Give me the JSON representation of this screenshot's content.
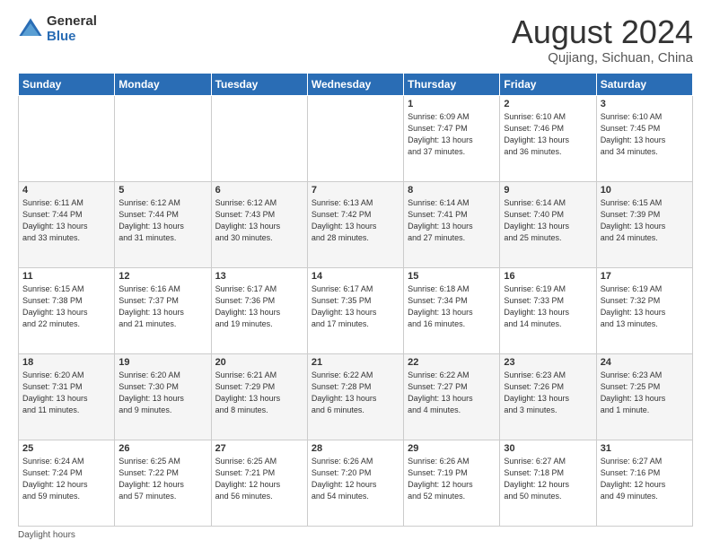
{
  "logo": {
    "general": "General",
    "blue": "Blue"
  },
  "title": "August 2024",
  "subtitle": "Qujiang, Sichuan, China",
  "days_of_week": [
    "Sunday",
    "Monday",
    "Tuesday",
    "Wednesday",
    "Thursday",
    "Friday",
    "Saturday"
  ],
  "footer": "Daylight hours",
  "weeks": [
    [
      {
        "day": "",
        "info": ""
      },
      {
        "day": "",
        "info": ""
      },
      {
        "day": "",
        "info": ""
      },
      {
        "day": "",
        "info": ""
      },
      {
        "day": "1",
        "info": "Sunrise: 6:09 AM\nSunset: 7:47 PM\nDaylight: 13 hours\nand 37 minutes."
      },
      {
        "day": "2",
        "info": "Sunrise: 6:10 AM\nSunset: 7:46 PM\nDaylight: 13 hours\nand 36 minutes."
      },
      {
        "day": "3",
        "info": "Sunrise: 6:10 AM\nSunset: 7:45 PM\nDaylight: 13 hours\nand 34 minutes."
      }
    ],
    [
      {
        "day": "4",
        "info": "Sunrise: 6:11 AM\nSunset: 7:44 PM\nDaylight: 13 hours\nand 33 minutes."
      },
      {
        "day": "5",
        "info": "Sunrise: 6:12 AM\nSunset: 7:44 PM\nDaylight: 13 hours\nand 31 minutes."
      },
      {
        "day": "6",
        "info": "Sunrise: 6:12 AM\nSunset: 7:43 PM\nDaylight: 13 hours\nand 30 minutes."
      },
      {
        "day": "7",
        "info": "Sunrise: 6:13 AM\nSunset: 7:42 PM\nDaylight: 13 hours\nand 28 minutes."
      },
      {
        "day": "8",
        "info": "Sunrise: 6:14 AM\nSunset: 7:41 PM\nDaylight: 13 hours\nand 27 minutes."
      },
      {
        "day": "9",
        "info": "Sunrise: 6:14 AM\nSunset: 7:40 PM\nDaylight: 13 hours\nand 25 minutes."
      },
      {
        "day": "10",
        "info": "Sunrise: 6:15 AM\nSunset: 7:39 PM\nDaylight: 13 hours\nand 24 minutes."
      }
    ],
    [
      {
        "day": "11",
        "info": "Sunrise: 6:15 AM\nSunset: 7:38 PM\nDaylight: 13 hours\nand 22 minutes."
      },
      {
        "day": "12",
        "info": "Sunrise: 6:16 AM\nSunset: 7:37 PM\nDaylight: 13 hours\nand 21 minutes."
      },
      {
        "day": "13",
        "info": "Sunrise: 6:17 AM\nSunset: 7:36 PM\nDaylight: 13 hours\nand 19 minutes."
      },
      {
        "day": "14",
        "info": "Sunrise: 6:17 AM\nSunset: 7:35 PM\nDaylight: 13 hours\nand 17 minutes."
      },
      {
        "day": "15",
        "info": "Sunrise: 6:18 AM\nSunset: 7:34 PM\nDaylight: 13 hours\nand 16 minutes."
      },
      {
        "day": "16",
        "info": "Sunrise: 6:19 AM\nSunset: 7:33 PM\nDaylight: 13 hours\nand 14 minutes."
      },
      {
        "day": "17",
        "info": "Sunrise: 6:19 AM\nSunset: 7:32 PM\nDaylight: 13 hours\nand 13 minutes."
      }
    ],
    [
      {
        "day": "18",
        "info": "Sunrise: 6:20 AM\nSunset: 7:31 PM\nDaylight: 13 hours\nand 11 minutes."
      },
      {
        "day": "19",
        "info": "Sunrise: 6:20 AM\nSunset: 7:30 PM\nDaylight: 13 hours\nand 9 minutes."
      },
      {
        "day": "20",
        "info": "Sunrise: 6:21 AM\nSunset: 7:29 PM\nDaylight: 13 hours\nand 8 minutes."
      },
      {
        "day": "21",
        "info": "Sunrise: 6:22 AM\nSunset: 7:28 PM\nDaylight: 13 hours\nand 6 minutes."
      },
      {
        "day": "22",
        "info": "Sunrise: 6:22 AM\nSunset: 7:27 PM\nDaylight: 13 hours\nand 4 minutes."
      },
      {
        "day": "23",
        "info": "Sunrise: 6:23 AM\nSunset: 7:26 PM\nDaylight: 13 hours\nand 3 minutes."
      },
      {
        "day": "24",
        "info": "Sunrise: 6:23 AM\nSunset: 7:25 PM\nDaylight: 13 hours\nand 1 minute."
      }
    ],
    [
      {
        "day": "25",
        "info": "Sunrise: 6:24 AM\nSunset: 7:24 PM\nDaylight: 12 hours\nand 59 minutes."
      },
      {
        "day": "26",
        "info": "Sunrise: 6:25 AM\nSunset: 7:22 PM\nDaylight: 12 hours\nand 57 minutes."
      },
      {
        "day": "27",
        "info": "Sunrise: 6:25 AM\nSunset: 7:21 PM\nDaylight: 12 hours\nand 56 minutes."
      },
      {
        "day": "28",
        "info": "Sunrise: 6:26 AM\nSunset: 7:20 PM\nDaylight: 12 hours\nand 54 minutes."
      },
      {
        "day": "29",
        "info": "Sunrise: 6:26 AM\nSunset: 7:19 PM\nDaylight: 12 hours\nand 52 minutes."
      },
      {
        "day": "30",
        "info": "Sunrise: 6:27 AM\nSunset: 7:18 PM\nDaylight: 12 hours\nand 50 minutes."
      },
      {
        "day": "31",
        "info": "Sunrise: 6:27 AM\nSunset: 7:16 PM\nDaylight: 12 hours\nand 49 minutes."
      }
    ]
  ]
}
